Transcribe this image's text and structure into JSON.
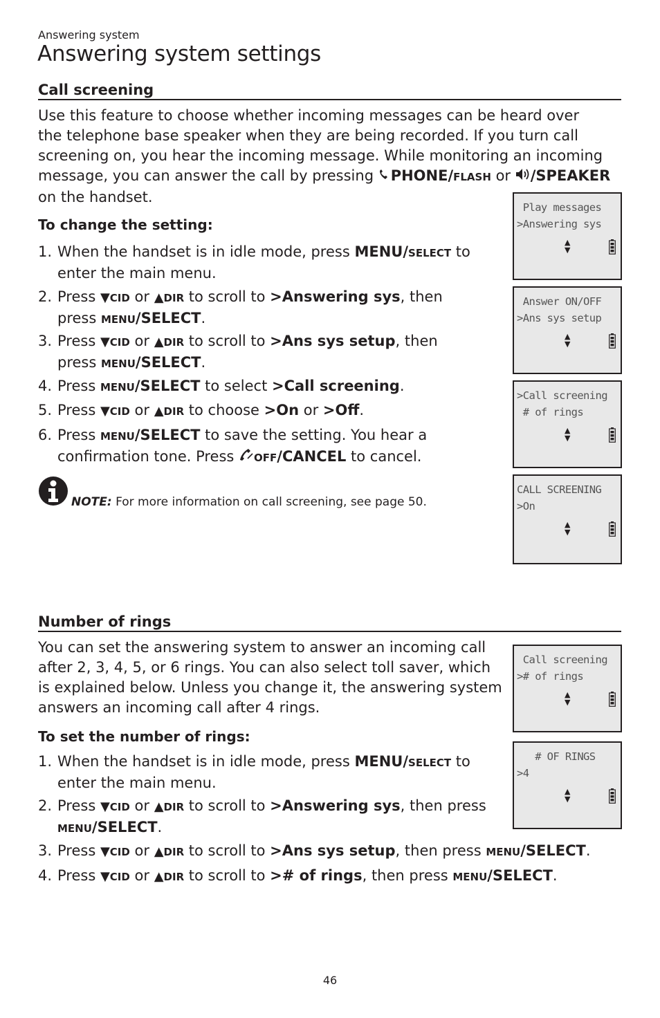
{
  "header": {
    "section": "Answering system",
    "title": "Answering system settings"
  },
  "call_screening": {
    "heading": "Call screening",
    "intro": {
      "l1": "Use this feature to choose whether incoming messages can be heard over",
      "l2": "the telephone base speaker when they are being recorded. If you turn call",
      "l3": "screening on, you hear the incoming message. While monitoring an incoming",
      "l4_a": "message, you can answer the call by pressing ",
      "phone_key": "PHONE/",
      "flash_key": "flash",
      "or": " or ",
      "speaker_key": "/SPEAKER",
      "l5": "on the handset."
    },
    "subheading": "To change the setting:",
    "steps": {
      "s1": {
        "num": "1.",
        "a": "When the handset is in idle mode, press ",
        "k1": "MENU/",
        "k2": "select",
        "b": " to",
        "c": "enter the main menu."
      },
      "s2": {
        "num": "2.",
        "a": "Press ",
        "cid": "CID",
        "or": " or ",
        "dir": "DIR",
        "b": " to scroll to ",
        "target": ">Answering sys",
        "c": ", then",
        "d": "press ",
        "menu": "menu",
        "select": "/SELECT",
        "end": "."
      },
      "s3": {
        "num": "3.",
        "a": "Press ",
        "cid": "CID",
        "or": " or ",
        "dir": "DIR",
        "b": " to scroll to ",
        "target": ">Ans sys setup",
        "c": ", then",
        "d": "press ",
        "menu": "menu",
        "select": "/SELECT",
        "end": "."
      },
      "s4": {
        "num": "4.",
        "a": "Press ",
        "menu": "menu",
        "select": "/SELECT",
        "b": " to select ",
        "target": ">Call screening",
        "end": "."
      },
      "s5": {
        "num": "5.",
        "a": "Press ",
        "cid": "CID",
        "or": " or ",
        "dir": "DIR",
        "b": " to choose ",
        "on": ">On",
        "or2": " or ",
        "off": ">Off",
        "end": "."
      },
      "s6": {
        "num": "6.",
        "a": "Press ",
        "menu": "menu",
        "select": "/SELECT",
        "b": " to save the setting. You hear a",
        "c": "confirmation tone. Press ",
        "off": "off",
        "cancel": "/CANCEL",
        "d": " to cancel."
      }
    },
    "note": {
      "label": "NOTE:",
      "text": " For more information on call screening, see page 50."
    }
  },
  "number_of_rings": {
    "heading": "Number of rings",
    "intro": {
      "l1": "You can set the answering system to answer an incoming call",
      "l2": "after 2, 3, 4, 5, or 6 rings. You can also select toll saver, which",
      "l3": "is explained below. Unless you change it, the answering system",
      "l4": "answers an incoming call after 4 rings."
    },
    "subheading": "To set the number of rings:",
    "steps": {
      "s1": {
        "num": "1.",
        "a": "When the handset is in idle mode, press ",
        "k1": "MENU/",
        "k2": "select",
        "b": " to",
        "c": "enter the main menu."
      },
      "s2": {
        "num": "2.",
        "a": "Press ",
        "cid": "CID",
        "or": " or ",
        "dir": "DIR",
        "b": " to scroll to ",
        "target": ">Answering sys",
        "c": ", then press",
        "menu": "menu",
        "select": "/SELECT",
        "end": "."
      },
      "s3": {
        "num": "3.",
        "a": "Press ",
        "cid": "CID",
        "or": " or ",
        "dir": "DIR",
        "b": " to scroll to ",
        "target": ">Ans sys setup",
        "c": ", then press ",
        "menu": "menu",
        "select": "/SELECT",
        "end": "."
      },
      "s4": {
        "num": "4.",
        "a": "Press ",
        "cid": "CID",
        "or": " or ",
        "dir": "DIR",
        "b": " to scroll to ",
        "target": "># of rings",
        "c": ", then press ",
        "menu": "menu",
        "select": "/SELECT",
        "end": "."
      }
    }
  },
  "screens": {
    "cs1": {
      "l1": " Play messages",
      "l2": ">Answering sys"
    },
    "cs2": {
      "l1": " Answer ON/OFF",
      "l2": ">Ans sys setup"
    },
    "cs3": {
      "l1": ">Call screening",
      "l2": " # of rings"
    },
    "cs4": {
      "l1": "CALL SCREENING",
      "l2": ">On"
    },
    "nr1": {
      "l1": " Call screening",
      "l2": "># of rings"
    },
    "nr2": {
      "l1": "   # OF RINGS",
      "l2": ">4"
    }
  },
  "icons": {
    "down_arrow": "▼",
    "up_arrow": "▲",
    "scroll_up": "▲",
    "scroll_down": "▼"
  },
  "footer": {
    "page_number": "46"
  }
}
